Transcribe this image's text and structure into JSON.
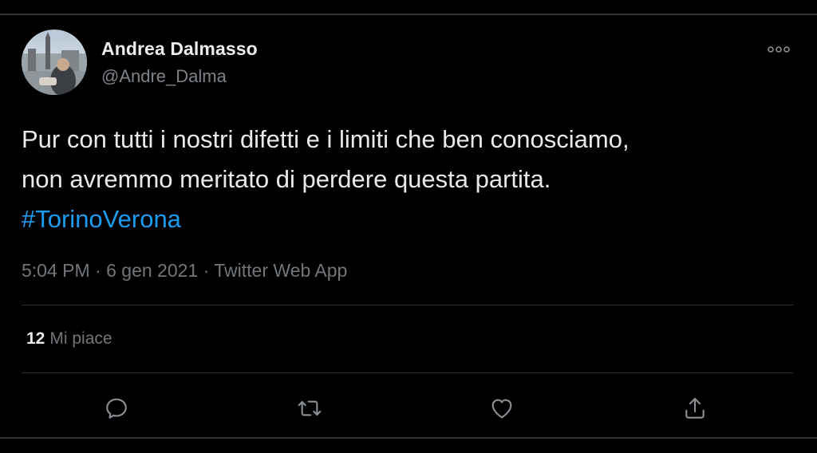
{
  "author": {
    "name": "Andrea Dalmasso",
    "handle": "@Andre_Dalma"
  },
  "tweet": {
    "line1": "Pur con tutti i nostri difetti e i limiti che ben conosciamo,",
    "line2": "non avremmo meritato di perdere questa partita.",
    "hashtag": "#TorinoVerona"
  },
  "meta": {
    "time": "5:04 PM",
    "separator": "·",
    "date": "6 gen 2021",
    "source": "Twitter Web App"
  },
  "stats": {
    "likes_count": "12",
    "likes_label": "Mi piace"
  },
  "icons": {
    "more": "more-horizontal-icon",
    "reply": "reply-icon",
    "retweet": "retweet-icon",
    "like": "heart-icon",
    "share": "share-icon"
  },
  "colors": {
    "background": "#000000",
    "hashtag": "#1d9bf0",
    "secondary_text": "#71767b",
    "primary_text": "#e7e9ea",
    "divider": "#2f3336"
  }
}
